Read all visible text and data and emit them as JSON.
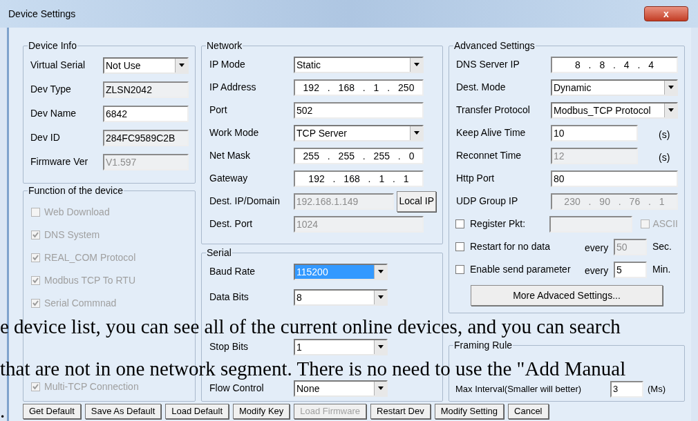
{
  "window": {
    "title": "Device Settings",
    "close": "x"
  },
  "device_info": {
    "title": "Device Info",
    "rows": [
      {
        "kind": "select",
        "label": "Virtual Serial",
        "value": "Not Use"
      },
      {
        "kind": "field",
        "label": "Dev Type",
        "value": "ZLSN2042",
        "editable": false,
        "disabled": false
      },
      {
        "kind": "field",
        "label": "Dev Name",
        "value": "6842",
        "editable": true,
        "disabled": false
      },
      {
        "kind": "field",
        "label": "Dev ID",
        "value": "284FC9589C2B",
        "editable": false,
        "disabled": false
      },
      {
        "kind": "field",
        "label": "Firmware Ver",
        "value": "V1.597",
        "editable": false,
        "disabled": true
      }
    ]
  },
  "functions": {
    "title": "Function of the device",
    "items": [
      {
        "label": "Web Download",
        "checked": false,
        "disabled": true
      },
      {
        "label": "DNS System",
        "checked": true,
        "disabled": true
      },
      {
        "label": "REAL_COM Protocol",
        "checked": true,
        "disabled": true
      },
      {
        "label": "Modbus TCP To RTU",
        "checked": true,
        "disabled": true
      },
      {
        "label": "Serial Commnad",
        "checked": true,
        "disabled": true
      },
      {
        "label": "Multi-TCP Connection",
        "checked": true,
        "disabled": true
      }
    ]
  },
  "network": {
    "title": "Network",
    "rows": [
      {
        "kind": "select",
        "label": "IP Mode",
        "value": "Static"
      },
      {
        "kind": "ip",
        "label": "IP Address",
        "value": "192 . 168 . 1 . 250",
        "disabled": false
      },
      {
        "kind": "field",
        "label": "Port",
        "value": "502",
        "editable": true,
        "disabled": false
      },
      {
        "kind": "select",
        "label": "Work Mode",
        "value": "TCP Server"
      },
      {
        "kind": "ip",
        "label": "Net Mask",
        "value": "255 . 255 . 255 . 0",
        "disabled": false
      },
      {
        "kind": "ip",
        "label": "Gateway",
        "value": "192 . 168 . 1 . 1",
        "disabled": false
      },
      {
        "kind": "field",
        "label": "Dest. IP/Domain",
        "value": "192.168.1.149",
        "editable": false,
        "disabled": true,
        "button": "Local IP"
      },
      {
        "kind": "field",
        "label": "Dest. Port",
        "value": "1024",
        "editable": false,
        "disabled": true
      }
    ]
  },
  "serial": {
    "title": "Serial",
    "rows": [
      {
        "kind": "select",
        "label": "Baud Rate",
        "value": "115200",
        "focused": true
      },
      {
        "kind": "select",
        "label": "Data Bits",
        "value": "8",
        "focused": false
      },
      {
        "kind": "select",
        "label": "Stop Bits",
        "value": "1",
        "focused": false
      },
      {
        "kind": "select",
        "label": "Flow Control",
        "value": "None",
        "focused": false
      }
    ]
  },
  "advanced": {
    "title": "Advanced Settings",
    "rows": [
      {
        "kind": "ip",
        "label": "DNS Server IP",
        "value": "8 . 8 . 4 . 4",
        "disabled": false
      },
      {
        "kind": "select",
        "label": "Dest. Mode",
        "value": "Dynamic"
      },
      {
        "kind": "select",
        "label": "Transfer Protocol",
        "value": "Modbus_TCP Protocol"
      },
      {
        "kind": "field",
        "label": "Keep Alive Time",
        "value": "10",
        "editable": true,
        "disabled": false,
        "unit": "(s)"
      },
      {
        "kind": "field",
        "label": "Reconnet Time",
        "value": "12",
        "editable": false,
        "disabled": true,
        "unit": "(s)"
      },
      {
        "kind": "field",
        "label": "Http Port",
        "value": "80",
        "editable": true,
        "disabled": false
      },
      {
        "kind": "ip",
        "label": "UDP Group IP",
        "value": "230 . 90 . 76 . 1",
        "disabled": true
      }
    ],
    "register": {
      "label": "Register Pkt:",
      "checked": false,
      "field_disabled": true,
      "ascii": {
        "label": "ASCII",
        "checked": false,
        "disabled": true
      }
    },
    "timers": [
      {
        "label": "Restart for no data",
        "checked": false,
        "every": "every",
        "value": "50",
        "disabled": true,
        "unit": "Sec."
      },
      {
        "label": "Enable send parameter",
        "checked": false,
        "every": "every",
        "value": "5",
        "disabled": false,
        "unit": "Min."
      }
    ],
    "more_button": "More Advaced Settings..."
  },
  "framing": {
    "title": "Framing Rule",
    "rows": [
      {
        "label": "Max Interval(Smaller will better)",
        "value": "3",
        "unit": "(Ms)"
      }
    ]
  },
  "buttons": [
    {
      "label": "Get Default",
      "disabled": false
    },
    {
      "label": "Save As Default",
      "disabled": false
    },
    {
      "label": "Load Default",
      "disabled": false
    },
    {
      "label": "Modify Key",
      "disabled": false
    },
    {
      "label": "Load Firmware",
      "disabled": true
    },
    {
      "label": "Restart Dev",
      "disabled": false
    },
    {
      "label": "Modify Setting",
      "disabled": false
    },
    {
      "label": "Cancel",
      "disabled": false
    }
  ],
  "overlay_text": [
    "e device list, you can see all of the current online devices, and you can search",
    "that are not in one network segment. There is no need to use the \"Add Manual",
    "."
  ]
}
